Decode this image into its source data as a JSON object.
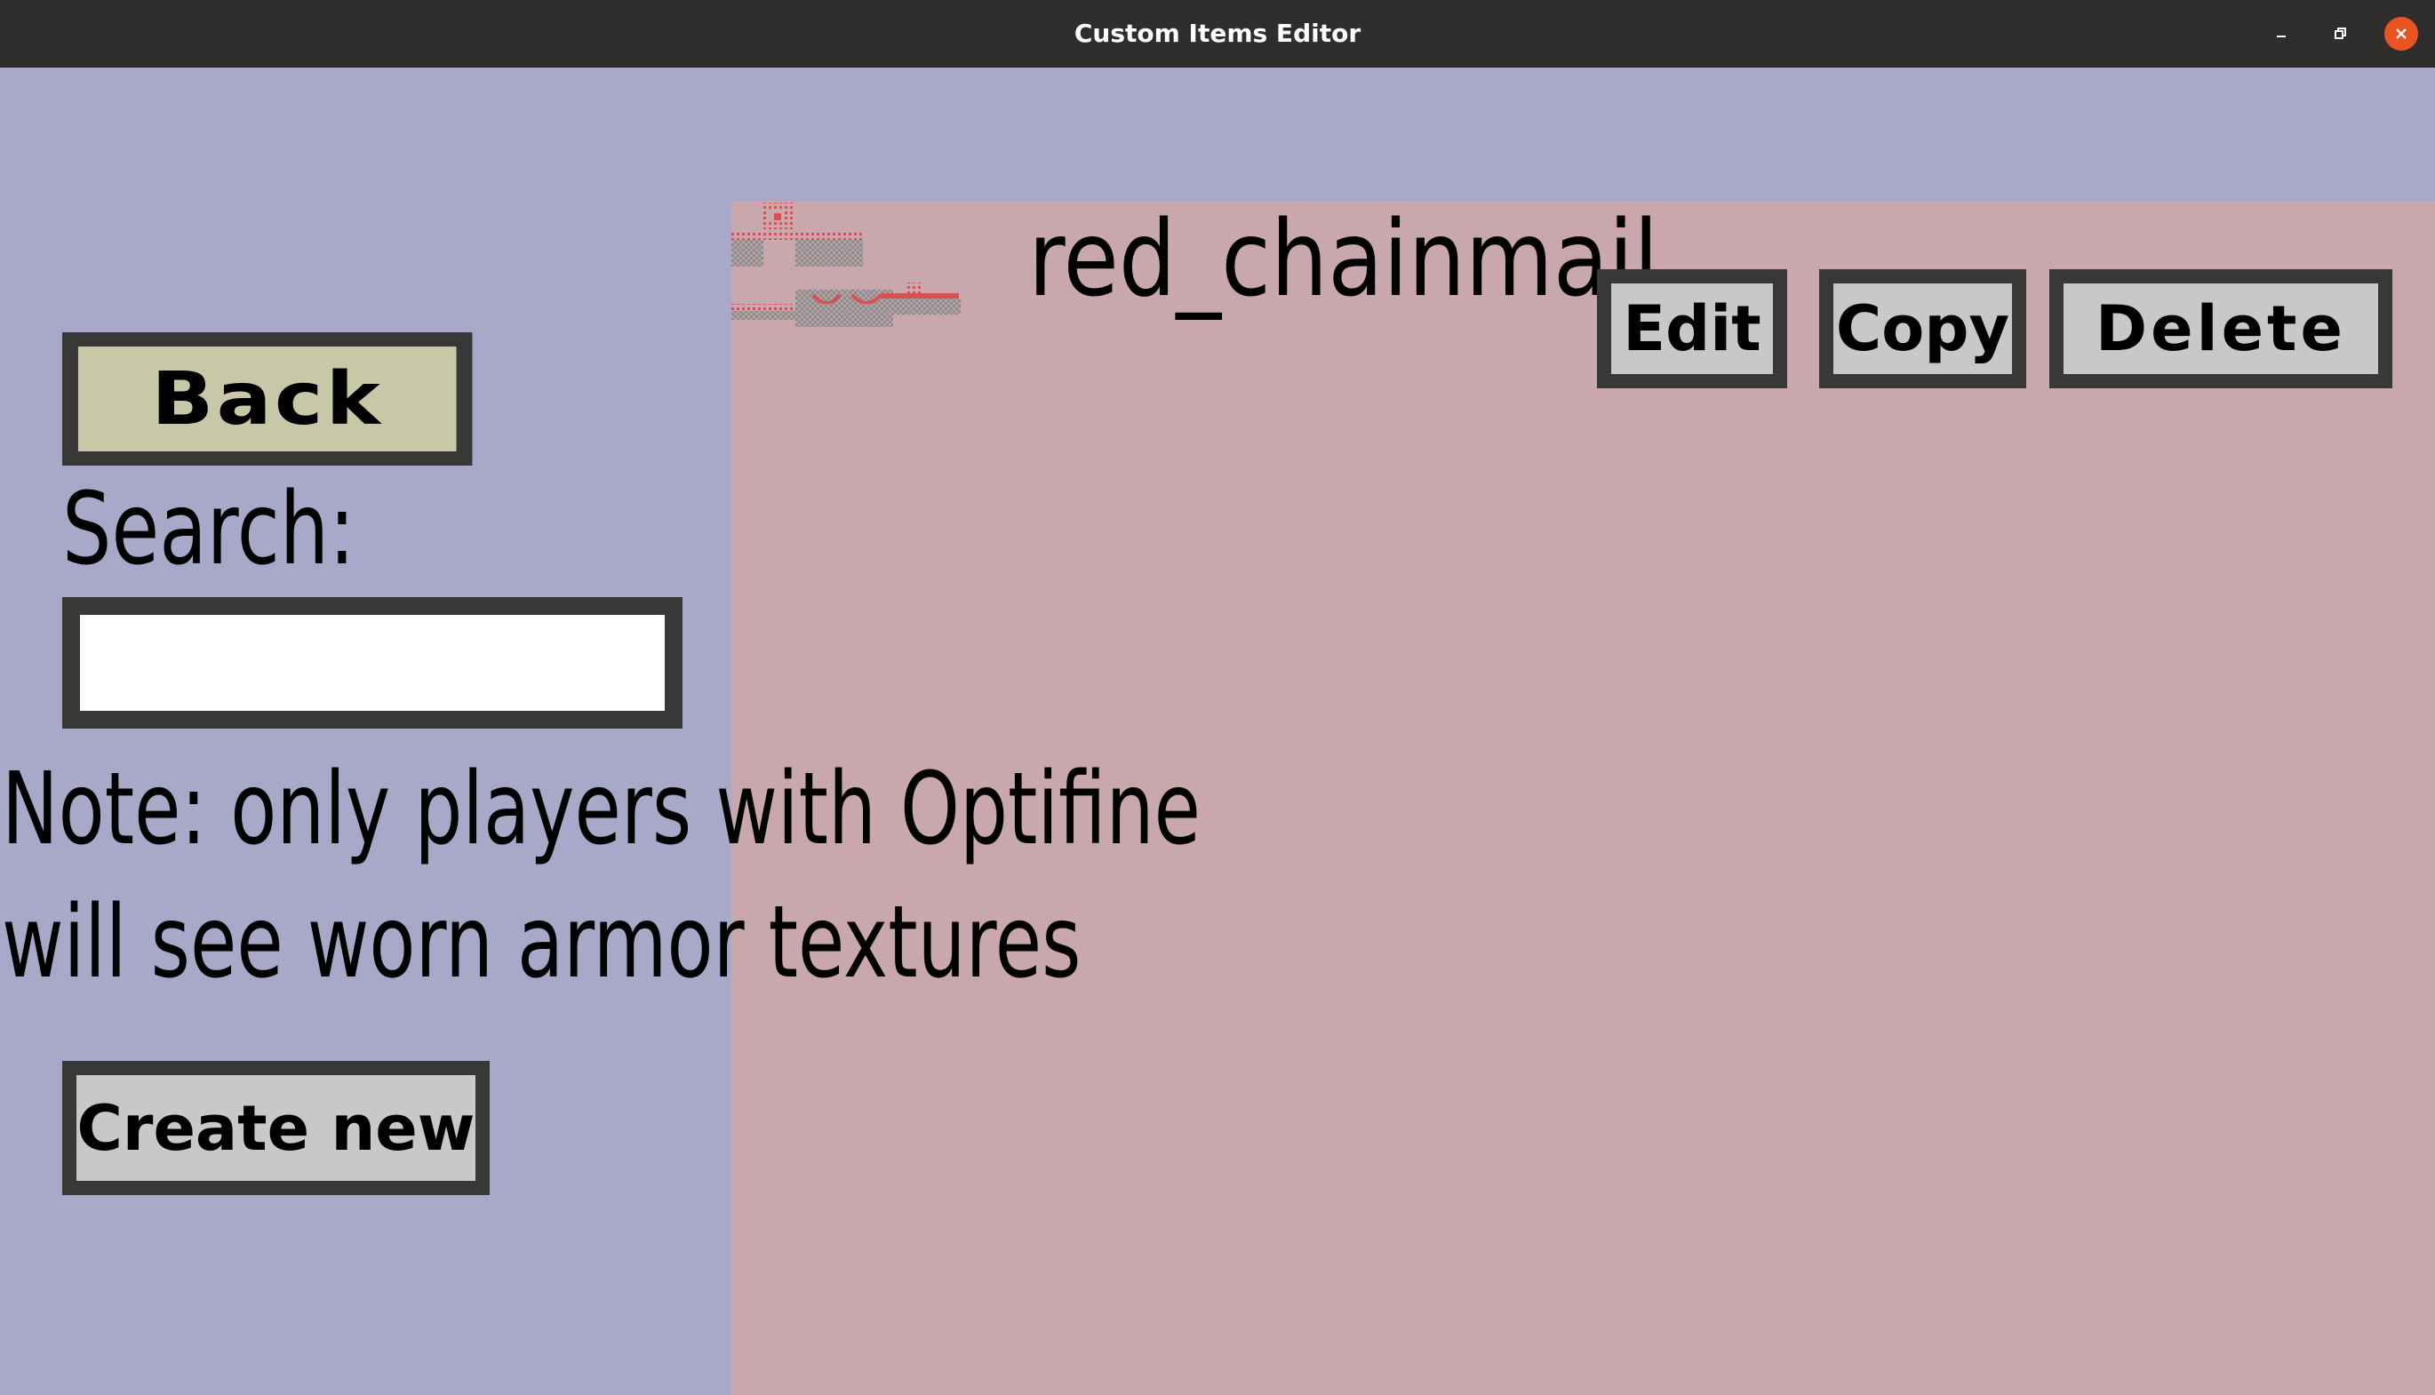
{
  "window": {
    "title": "Custom Items Editor",
    "controls": {
      "minimize_glyph": "–",
      "maximize_glyph": "❐",
      "close_glyph": "✕"
    }
  },
  "sidebar": {
    "back_label": "Back",
    "search_label": "Search:",
    "search_value": "",
    "note_lines": [
      "Note: only players with Optifine",
      "will see worn armor textures"
    ],
    "create_label": "Create new"
  },
  "items": [
    {
      "name": "red_chainmail",
      "icon": "chainmail-armor-texture-icon",
      "edit_label": "Edit",
      "copy_label": "Copy",
      "delete_label": "Delete"
    }
  ],
  "colors": {
    "background": "#a8a8c8",
    "list_panel": "#c8a8ac",
    "button_face": "#c8c8c8",
    "back_button_face": "#c8c8a8",
    "button_border": "#383838",
    "titlebar": "#2f2e2d",
    "close_button": "#e95420"
  }
}
